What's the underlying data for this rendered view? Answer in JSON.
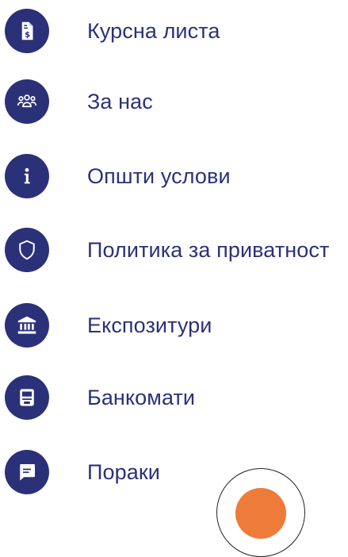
{
  "menu": {
    "items": [
      {
        "label": "Курсна листа",
        "icon": "exchange-document-icon"
      },
      {
        "label": "За нас",
        "icon": "people-group-icon"
      },
      {
        "label": "Општи услови",
        "icon": "info-icon"
      },
      {
        "label": "Политика за приватност",
        "icon": "shield-icon"
      },
      {
        "label": "Експозитури",
        "icon": "bank-building-icon"
      },
      {
        "label": "Банкомати",
        "icon": "atm-icon"
      },
      {
        "label": "Пораки",
        "icon": "message-icon"
      }
    ]
  },
  "colors": {
    "primary": "#2b3178",
    "accent": "#ef7b3b",
    "background": "#ffffff"
  }
}
